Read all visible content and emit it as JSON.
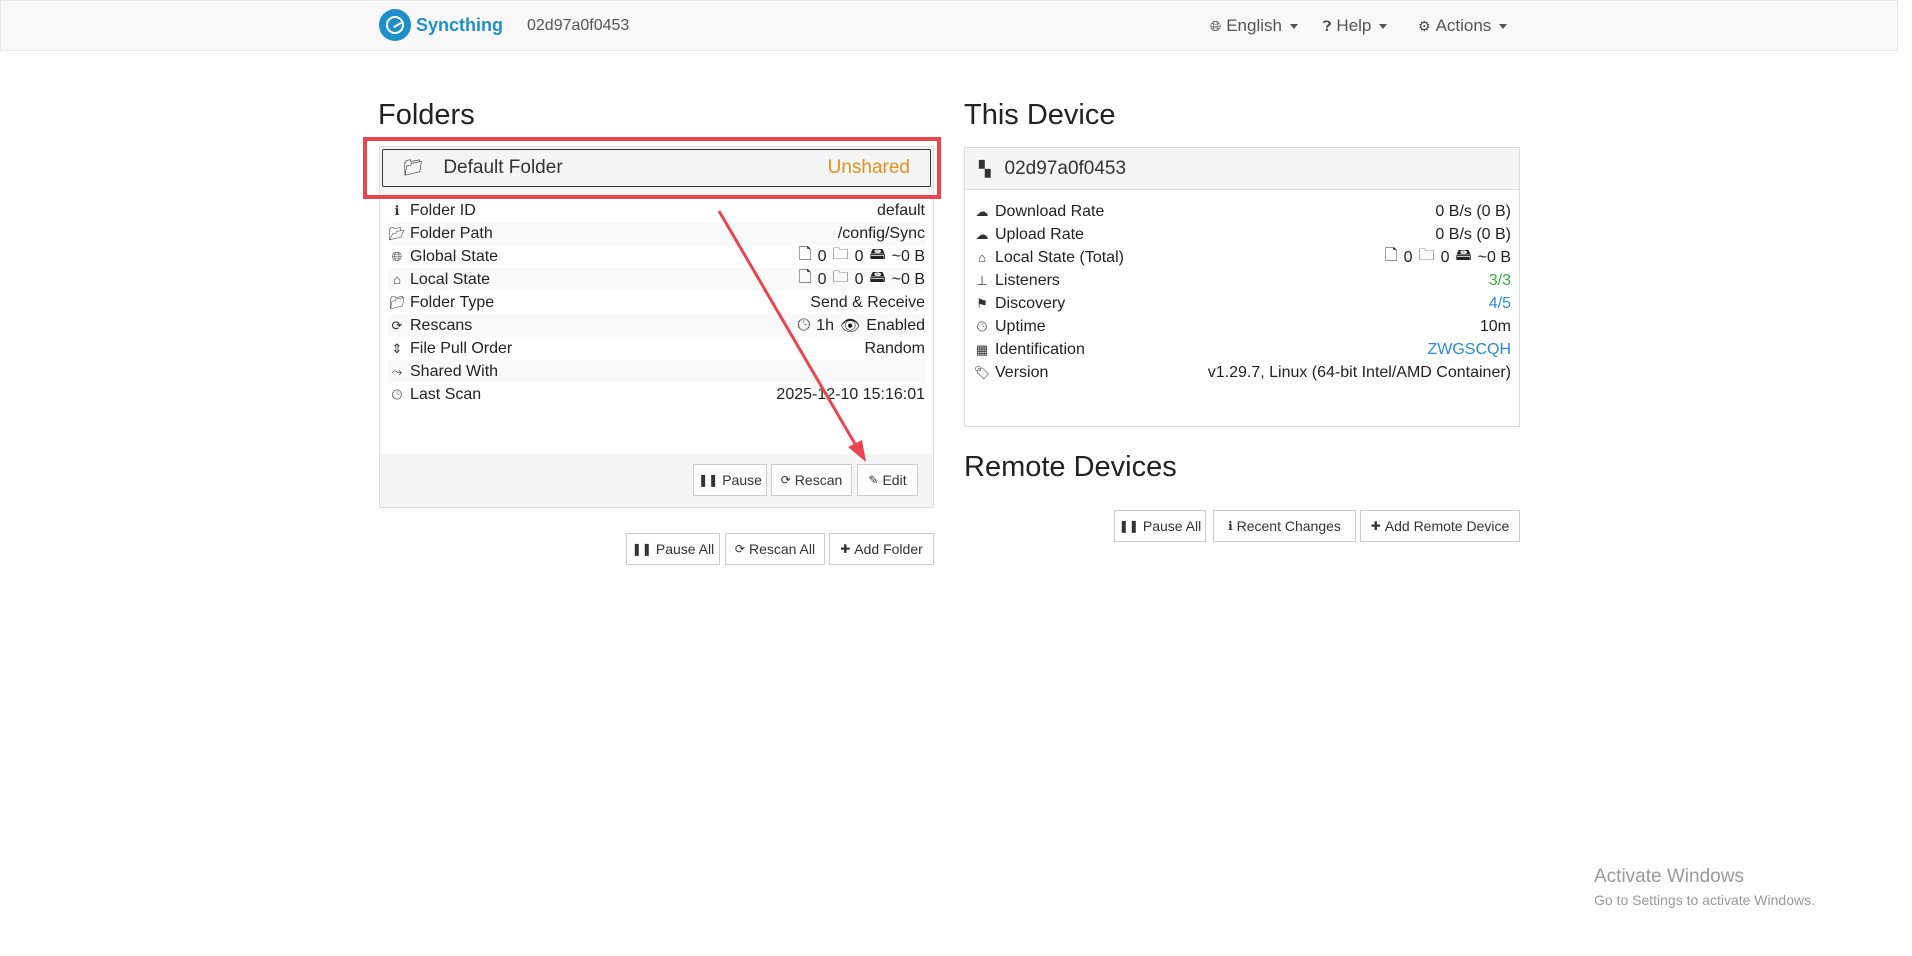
{
  "nav": {
    "brand": "Syncthing",
    "device_id": "02d97a0f0453",
    "language": "English",
    "help": "Help",
    "actions": "Actions"
  },
  "folders": {
    "heading": "Folders",
    "folder": {
      "name": "Default Folder",
      "status": "Unshared",
      "rows": [
        {
          "label": "Folder ID",
          "value": "default"
        },
        {
          "label": "Folder Path",
          "value": "/config/Sync"
        },
        {
          "label": "Global State",
          "files": "0",
          "dirs": "0",
          "size": "~0 B"
        },
        {
          "label": "Local State",
          "files": "0",
          "dirs": "0",
          "size": "~0 B"
        },
        {
          "label": "Folder Type",
          "value": "Send & Receive"
        },
        {
          "label": "Rescans",
          "interval": "1h",
          "watch": "Enabled"
        },
        {
          "label": "File Pull Order",
          "value": "Random"
        },
        {
          "label": "Shared With",
          "value": ""
        },
        {
          "label": "Last Scan",
          "value": "2025-12-10 15:16:01"
        }
      ],
      "buttons": {
        "pause": "Pause",
        "rescan": "Rescan",
        "edit": "Edit"
      }
    },
    "buttons": {
      "pause_all": "Pause All",
      "rescan_all": "Rescan All",
      "add_folder": "Add Folder"
    }
  },
  "this_device": {
    "heading": "This Device",
    "name": "02d97a0f0453",
    "rows": [
      {
        "label": "Download Rate",
        "value": "0 B/s (0 B)"
      },
      {
        "label": "Upload Rate",
        "value": "0 B/s (0 B)"
      },
      {
        "label": "Local State (Total)",
        "files": "0",
        "dirs": "0",
        "size": "~0 B"
      },
      {
        "label": "Listeners",
        "value": "3/3"
      },
      {
        "label": "Discovery",
        "value": "4/5"
      },
      {
        "label": "Uptime",
        "value": "10m"
      },
      {
        "label": "Identification",
        "value": "ZWGSCQH"
      },
      {
        "label": "Version",
        "value": "v1.29.7, Linux (64-bit Intel/AMD Container)"
      }
    ]
  },
  "remote": {
    "heading": "Remote Devices",
    "buttons": {
      "pause_all": "Pause All",
      "recent_changes": "Recent Changes",
      "add_remote": "Add Remote Device"
    }
  },
  "watermark": {
    "title": "Activate Windows",
    "subtitle": "Go to Settings to activate Windows."
  },
  "colors": {
    "accent": "#1f8fc9",
    "unshared": "#e5901c",
    "ok": "#3ca83c",
    "link": "#2a8ad8",
    "annotation": "#e8454f"
  }
}
